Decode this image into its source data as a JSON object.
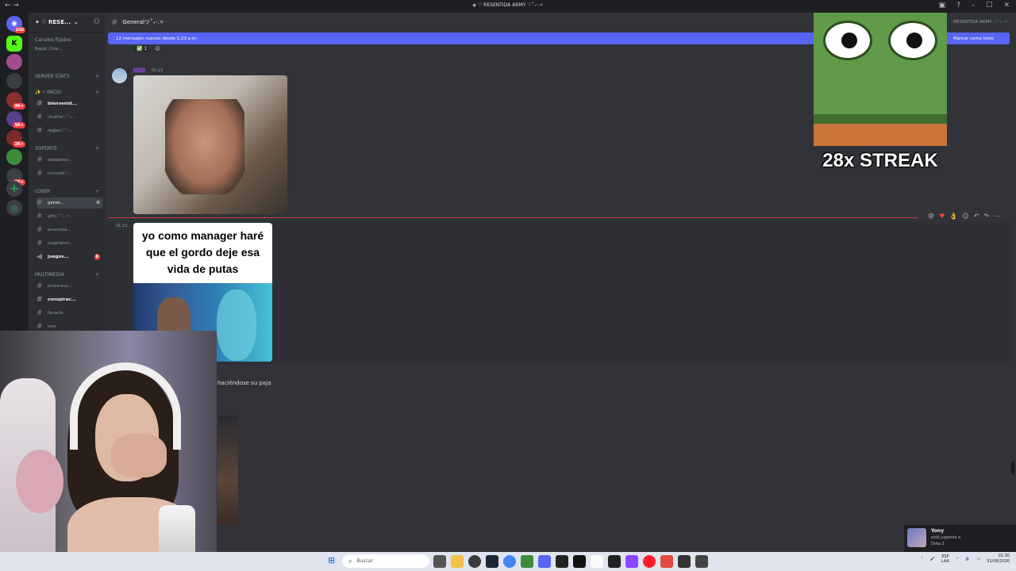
{
  "window": {
    "title": "◈ ♡ RESENTIDA ARMY ♡˚₊·.✧",
    "nav": "←  →",
    "buttons": [
      "▣",
      "?",
      "–",
      "☐",
      "✕"
    ]
  },
  "server_rail": {
    "items": [
      {
        "label": "",
        "badge": "200",
        "color": "#5865f2"
      },
      {
        "label": "K",
        "badge": "",
        "color": "#53fc18"
      },
      {
        "label": "",
        "badge": "",
        "color": "#a14d8f"
      },
      {
        "label": "",
        "badge": "",
        "color": "#3a3d44"
      },
      {
        "label": "",
        "badge": "9K+",
        "color": "#8b2f2f"
      },
      {
        "label": "",
        "badge": "5K+",
        "color": "#5a3f8c"
      },
      {
        "label": "",
        "badge": "2K+",
        "color": "#7a2b2b"
      },
      {
        "label": "",
        "badge": "",
        "color": "#3c8c3c"
      },
      {
        "label": "",
        "badge": "6K+",
        "color": "#3b3e45"
      },
      {
        "label": "",
        "badge": "39",
        "color": "#4a4d55"
      }
    ],
    "add_icon": "+",
    "discover_icon": "◎"
  },
  "sidebar": {
    "guild_name": "✦ ♡ RESE...",
    "pinned_label": "Canales fijados",
    "pinned_channel": "Rappi Cine...",
    "categories": [
      {
        "name": "SERVER STATS"
      },
      {
        "name": "✨ • INICIO"
      },
      {
        "name": "SOPORTE"
      },
      {
        "name": "LOBBY"
      },
      {
        "name": "MULTIMEDIA"
      }
    ],
    "channels": [
      {
        "name": "bienvenid..."
      },
      {
        "name": "chatito♡˚₊..."
      },
      {
        "name": "reglas♡˚₊..."
      },
      {
        "name": "desbaneo..."
      },
      {
        "name": "rol-subs♡..."
      },
      {
        "name": "gener..."
      },
      {
        "name": "gifs♡˚₊·.✧"
      },
      {
        "name": "anuncios..."
      },
      {
        "name": "sugerenci..."
      },
      {
        "name": "juegos...",
        "badge": "8"
      },
      {
        "name": "envia-tus-..."
      },
      {
        "name": "conspirac..."
      },
      {
        "name": "fanarts"
      },
      {
        "name": "lore"
      }
    ]
  },
  "main": {
    "channel_title": "Generalツ˚₊·.✧",
    "header_right": "RESENTIDA ARMY ♡˚₊·.✧",
    "new_messages": "12 mensajes nuevos desde 1:23 a.m.",
    "mark_read": "Marcar como leído",
    "reaction_count": "1",
    "msg1_time": "01:21",
    "msg2_time": "01:23",
    "meme_caption": "yo como manager haré que el gordo deje esa vida de putas",
    "msg3_text": "haciéndose su paja"
  },
  "streak": {
    "label": "28x STREAK"
  },
  "notification": {
    "name": "Yony",
    "status": "está jugando a",
    "game": "Dota 2"
  },
  "taskbar": {
    "search_placeholder": "Buscar",
    "lang_1": "ESP",
    "lang_2": "LAA",
    "time": "01:30",
    "date": "31/08/2026"
  },
  "colors": {
    "accent": "#5865f2",
    "new_line": "#f23f43",
    "bg": "#313338"
  }
}
